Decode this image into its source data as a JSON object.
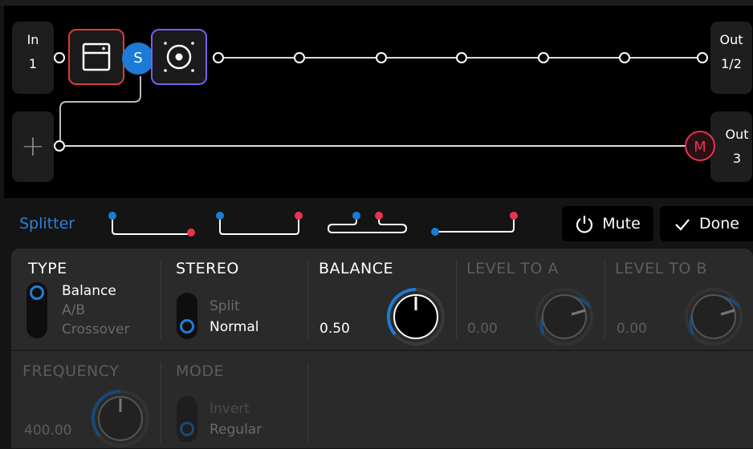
{
  "routing": {
    "input": {
      "label": "In",
      "channel": "1"
    },
    "output_main": {
      "label": "Out",
      "channel": "1/2"
    },
    "output_aux": {
      "label": "Out",
      "channel": "3"
    },
    "add_symbol": "+",
    "splitter_badge": "S",
    "mute_badge": "M",
    "blocks": [
      {
        "name": "amp-block",
        "color": "#e03a3a",
        "icon": "amp-icon"
      },
      {
        "name": "speaker-block",
        "color": "#7b5cf0",
        "icon": "speaker-icon"
      }
    ],
    "accent_red": "#e8334f",
    "accent_blue": "#1c7bd6"
  },
  "toolbar": {
    "title": "Splitter",
    "split_types": [
      "y-split-a",
      "y-split-b",
      "y-split-ab",
      "y-split-c"
    ],
    "mute_label": "Mute",
    "done_label": "Done"
  },
  "params": {
    "type": {
      "label": "TYPE",
      "options": [
        "Balance",
        "A/B",
        "Crossover"
      ],
      "selected": "Balance"
    },
    "stereo": {
      "label": "STEREO",
      "options": [
        "Split",
        "Normal"
      ],
      "selected": "Normal"
    },
    "balance": {
      "label": "BALANCE",
      "value": "0.50",
      "level": 0.5
    },
    "level_a": {
      "label": "LEVEL TO A",
      "value": "0.00",
      "level": 0.75
    },
    "level_b": {
      "label": "LEVEL TO B",
      "value": "0.00",
      "level": 0.75
    },
    "frequency": {
      "label": "FREQUENCY",
      "value": "400.00",
      "level": 0.5
    },
    "mode": {
      "label": "MODE",
      "options": [
        "Invert",
        "Regular"
      ],
      "selected": "Regular"
    }
  }
}
